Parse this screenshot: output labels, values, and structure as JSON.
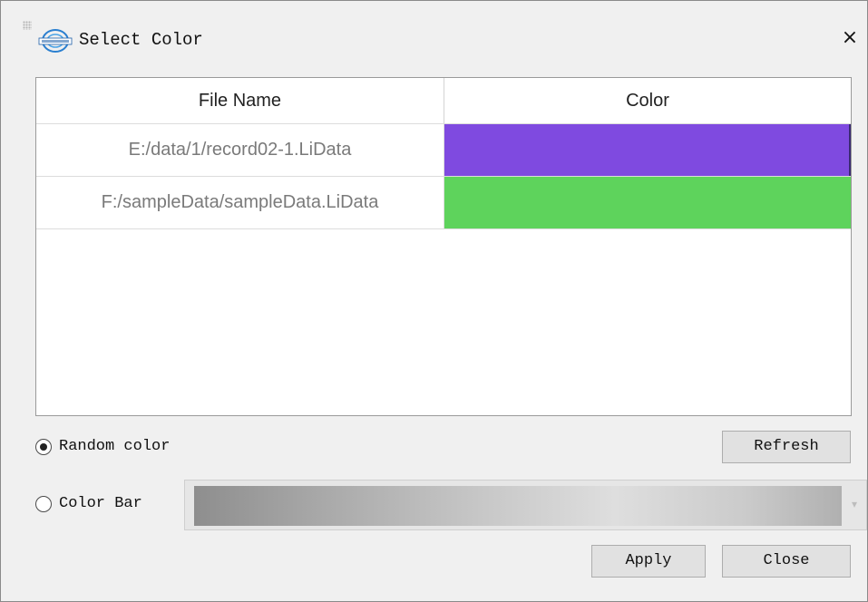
{
  "dialog": {
    "title": "Select Color",
    "close_glyph": "×"
  },
  "table": {
    "columns": [
      "File Name",
      "Color"
    ],
    "rows": [
      {
        "file": "E:/data/1/record02-1.LiData",
        "color": "#7f4ae0"
      },
      {
        "file": "F:/sampleData/sampleData.LiData",
        "color": "#5ed35c"
      }
    ]
  },
  "options": {
    "random_color": {
      "label": "Random color",
      "selected": true
    },
    "color_bar": {
      "label": "Color Bar",
      "selected": false
    }
  },
  "buttons": {
    "refresh": "Refresh",
    "apply": "Apply",
    "close": "Close"
  },
  "icons": {
    "app_logo": "app-logo-icon",
    "close": "close-icon",
    "dropdown": "chevron-down-icon"
  }
}
